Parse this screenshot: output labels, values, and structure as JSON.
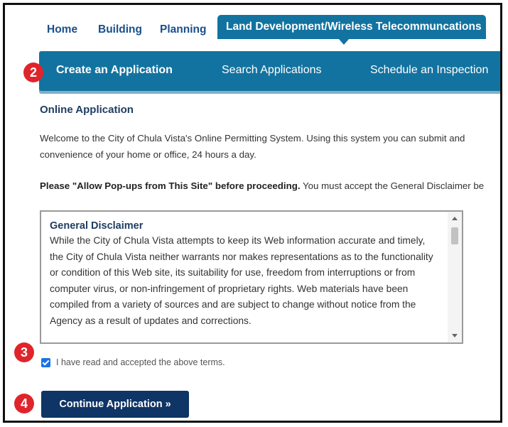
{
  "top_nav": {
    "tabs": [
      "Home",
      "Building",
      "Planning"
    ],
    "active_tab": "Land Development/Wireless Telecommuncations"
  },
  "sub_nav": {
    "items": [
      "Create an Application",
      "Search Applications",
      "Schedule an Inspection"
    ]
  },
  "badges": [
    "2",
    "3",
    "4"
  ],
  "content": {
    "section_title": "Online Application",
    "welcome_line1": "Welcome to the City of Chula Vista's Online Permitting System. Using this system you can submit and",
    "welcome_line2": "convenience of your home or office, 24 hours a day.",
    "popups_bold": "Please \"Allow Pop-ups from This Site\" before proceeding.",
    "popups_rest": " You must accept the General Disclaimer be"
  },
  "disclaimer": {
    "title": "General Disclaimer",
    "text": "While the City of Chula Vista attempts to keep its Web information accurate and timely, the City of Chula Vista neither warrants nor makes representations as to the functionality or condition of this Web site, its suitability for use, freedom from interruptions or from computer virus, or non-infringement of proprietary rights. Web materials have been compiled from a variety of sources and are subject to change without notice from the Agency as a result of updates and corrections."
  },
  "terms": {
    "checked": true,
    "label": "I have read and accepted the above terms."
  },
  "continue_button": "Continue Application »",
  "colors": {
    "nav_blue": "#1373a0",
    "button_navy": "#0f3466",
    "badge_red": "#e0242b",
    "link_blue": "#1a4f8b"
  }
}
